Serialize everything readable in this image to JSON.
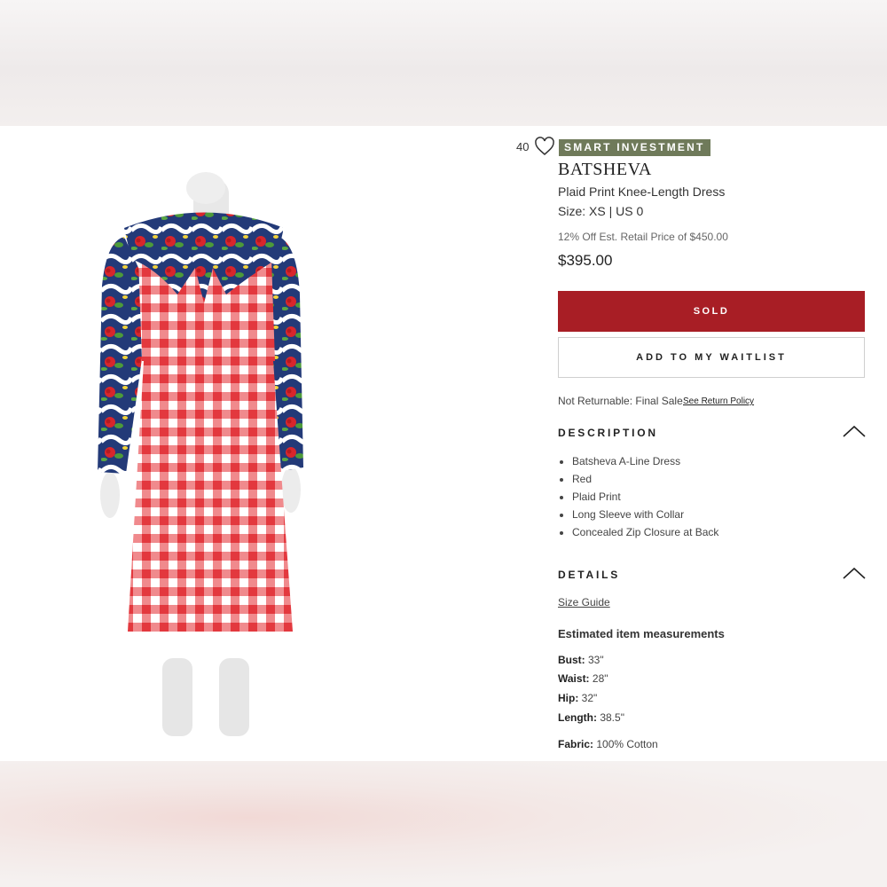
{
  "product": {
    "likes": "40",
    "badge": "SMART INVESTMENT",
    "brand": "BATSHEVA",
    "name": "Plaid Print Knee-Length Dress",
    "size": "Size: XS | US 0",
    "discount": "12% Off Est. Retail Price of $450.00",
    "price": "$395.00"
  },
  "actions": {
    "sold_label": "SOLD",
    "waitlist_label": "ADD TO MY WAITLIST"
  },
  "returns": {
    "text": "Not Returnable: Final Sale",
    "link": "See Return Policy"
  },
  "description": {
    "heading": "DESCRIPTION",
    "items": [
      "Batsheva A-Line Dress",
      "Red",
      "Plaid Print",
      "Long Sleeve with Collar",
      "Concealed Zip Closure at Back"
    ]
  },
  "details": {
    "heading": "DETAILS",
    "size_guide": "Size Guide",
    "measurements_title": "Estimated item measurements",
    "measurements": [
      {
        "label": "Bust:",
        "value": " 33\""
      },
      {
        "label": "Waist:",
        "value": " 28\""
      },
      {
        "label": "Hip:",
        "value": " 32\""
      },
      {
        "label": "Length:",
        "value": " 38.5\""
      }
    ],
    "fabric": {
      "label": "Fabric:",
      "value": " 100% Cotton"
    }
  },
  "colors": {
    "sold_red": "#a81e25",
    "badge_green": "#6f7a5a",
    "gingham_red": "#e8474c"
  }
}
